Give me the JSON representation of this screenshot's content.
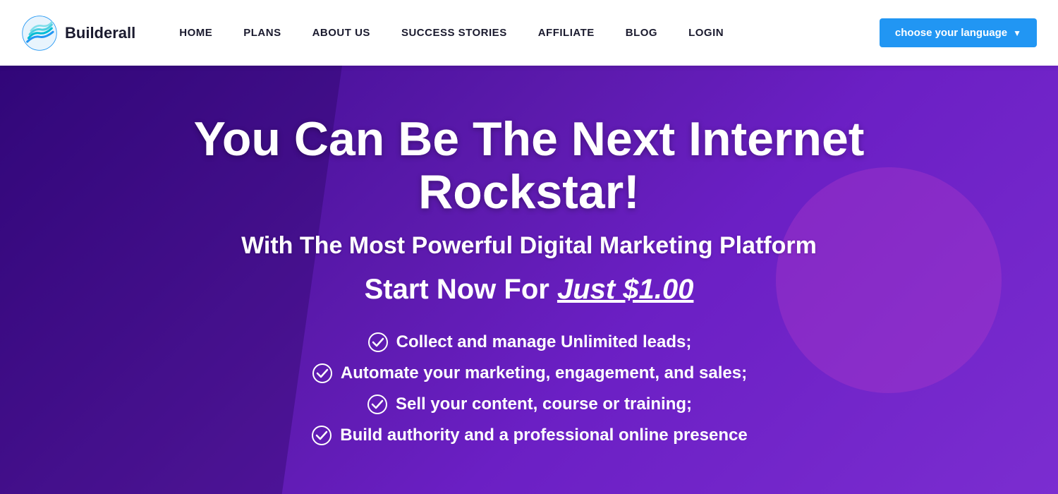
{
  "navbar": {
    "logo_text": "Builderall",
    "links": [
      {
        "label": "HOME",
        "id": "home"
      },
      {
        "label": "PLANS",
        "id": "plans"
      },
      {
        "label": "ABOUT US",
        "id": "about"
      },
      {
        "label": "SUCCESS STORIES",
        "id": "success"
      },
      {
        "label": "AFFILIATE",
        "id": "affiliate"
      },
      {
        "label": "BLOG",
        "id": "blog"
      },
      {
        "label": "LOGIN",
        "id": "login"
      }
    ],
    "language_button": "choose your language"
  },
  "hero": {
    "title": "You Can Be The Next Internet Rockstar!",
    "subtitle": "With The Most Powerful Digital Marketing Platform",
    "price_prefix": "Start Now For ",
    "price_value": "Just $1.00",
    "features": [
      "Collect and manage Unlimited leads;",
      "Automate your marketing, engagement, and sales;",
      "Sell your content, course or training;",
      "Build authority and a professional online presence"
    ]
  },
  "colors": {
    "brand_blue": "#2196f3",
    "hero_bg_start": "#3a0a8c",
    "hero_bg_end": "#7b2dd0",
    "nav_bg": "#ffffff",
    "text_white": "#ffffff",
    "text_dark": "#1a1a2e"
  }
}
